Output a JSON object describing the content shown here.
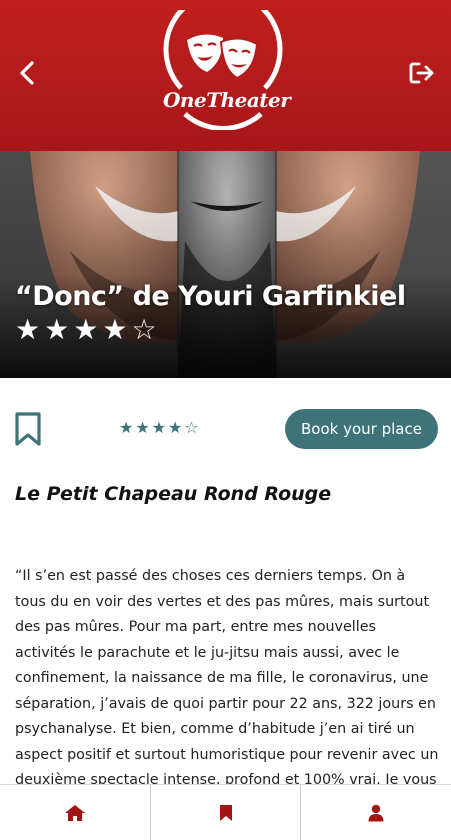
{
  "app": {
    "name": "OneTheater"
  },
  "show": {
    "title": "“Donc” de Youri Garfinkiel",
    "rating": 4,
    "rating_max": 5,
    "stars_hero": [
      "★",
      "★",
      "★",
      "★",
      "☆"
    ],
    "stars_small": [
      "★",
      "★",
      "★",
      "★",
      "☆"
    ],
    "venue": "Le Petit Chapeau Rond Rouge",
    "description": "“Il s’en est passé des choses ces derniers temps. On à tous du en voir des vertes et des pas mûres, mais surtout des pas mûres. Pour ma part, entre mes nouvelles activités le parachute et le ju-jitsu mais aussi, avec le confinement, la naissance de ma fille, le coronavirus, une séparation, j’avais de quoi partir pour 22 ans, 322 jours en psychanalyse. Et bien, comme d’habitude j’en ai tiré un aspect positif et surtout humoristique pour revenir avec un deuxième spectacle intense, profond et 100% vrai. Je vous parlerai"
  },
  "actions": {
    "book_label": "Book your place"
  },
  "icons": {
    "back": "chevron-left-icon",
    "logout": "logout-icon",
    "bookmark": "bookmark-icon",
    "home": "home-icon",
    "saved": "bookmark-icon",
    "profile": "user-icon"
  },
  "colors": {
    "brand_red": "#b31b1b",
    "accent_teal": "#3e7479",
    "nav_icon": "#a31515"
  }
}
